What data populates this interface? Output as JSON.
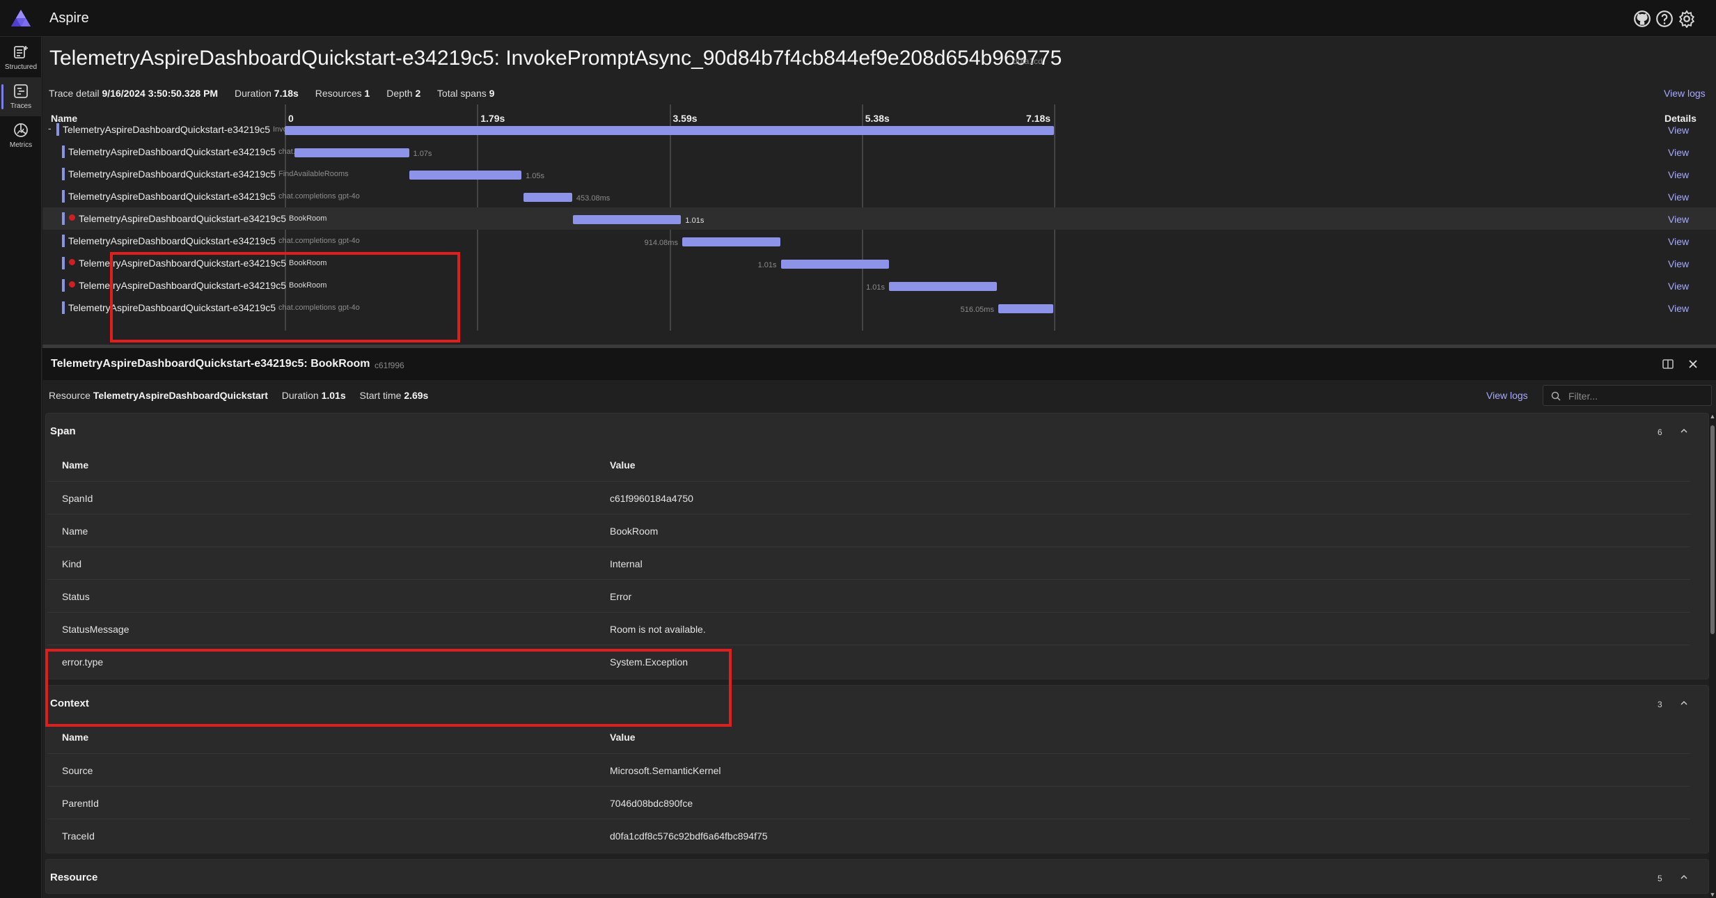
{
  "app": {
    "name": "Aspire"
  },
  "nav": {
    "items": [
      {
        "label": "Structured"
      },
      {
        "label": "Traces"
      },
      {
        "label": "Metrics"
      }
    ]
  },
  "trace": {
    "title": "TelemetryAspireDashboardQuickstart-e34219c5: InvokePromptAsync_90d84b7f4cb844ef9e208d654b969775",
    "trace_id_short": "d0fa1cd",
    "meta": {
      "detail_label": "Trace detail",
      "detail_value": "9/16/2024 3:50:50.328 PM",
      "duration_label": "Duration",
      "duration_value": "7.18s",
      "resources_label": "Resources",
      "resources_value": "1",
      "depth_label": "Depth",
      "depth_value": "2",
      "spans_label": "Total spans",
      "spans_value": "9"
    },
    "view_logs": "View logs",
    "columns": {
      "name": "Name",
      "details": "Details"
    },
    "ticks": [
      "0",
      "1.79s",
      "3.59s",
      "5.38s",
      "7.18s"
    ],
    "total_duration_s": 7.18,
    "rows": [
      {
        "name": "TelemetryAspireDashboardQuickstart-e34219c5",
        "operation": "InvokePromptAsync_90d84b7f4cb844ef9e...",
        "start_s": 0.0,
        "duration_s": 7.18,
        "label": "",
        "label_side": "right",
        "error": false,
        "level": 0,
        "toggle": "-",
        "view": "View"
      },
      {
        "name": "TelemetryAspireDashboardQuickstart-e34219c5",
        "operation": "chat.completions gpt-4o",
        "start_s": 0.09,
        "duration_s": 1.07,
        "label": "1.07s",
        "label_side": "right",
        "error": false,
        "level": 1,
        "toggle": "",
        "view": "View"
      },
      {
        "name": "TelemetryAspireDashboardQuickstart-e34219c5",
        "operation": "FindAvailableRooms",
        "start_s": 1.16,
        "duration_s": 1.05,
        "label": "1.05s",
        "label_side": "right",
        "error": false,
        "level": 1,
        "toggle": "",
        "view": "View"
      },
      {
        "name": "TelemetryAspireDashboardQuickstart-e34219c5",
        "operation": "chat.completions gpt-4o",
        "start_s": 2.23,
        "duration_s": 0.45308,
        "label": "453.08ms",
        "label_side": "right",
        "error": false,
        "level": 1,
        "toggle": "",
        "view": "View"
      },
      {
        "name": "TelemetryAspireDashboardQuickstart-e34219c5",
        "operation": "BookRoom",
        "start_s": 2.69,
        "duration_s": 1.01,
        "label": "1.01s",
        "label_side": "right",
        "error": true,
        "level": 1,
        "toggle": "",
        "view": "View",
        "selected": true
      },
      {
        "name": "TelemetryAspireDashboardQuickstart-e34219c5",
        "operation": "chat.completions gpt-4o",
        "start_s": 3.71,
        "duration_s": 0.91408,
        "label": "914.08ms",
        "label_side": "left",
        "error": false,
        "level": 1,
        "toggle": "",
        "view": "View"
      },
      {
        "name": "TelemetryAspireDashboardQuickstart-e34219c5",
        "operation": "BookRoom",
        "start_s": 4.63,
        "duration_s": 1.01,
        "label": "1.01s",
        "label_side": "left",
        "error": true,
        "level": 1,
        "toggle": "",
        "view": "View"
      },
      {
        "name": "TelemetryAspireDashboardQuickstart-e34219c5",
        "operation": "BookRoom",
        "start_s": 5.64,
        "duration_s": 1.01,
        "label": "1.01s",
        "label_side": "left",
        "error": true,
        "level": 1,
        "toggle": "",
        "view": "View"
      },
      {
        "name": "TelemetryAspireDashboardQuickstart-e34219c5",
        "operation": "chat.completions gpt-4o",
        "start_s": 6.66,
        "duration_s": 0.51605,
        "label": "516.05ms",
        "label_side": "left",
        "error": false,
        "level": 1,
        "toggle": "",
        "view": "View"
      }
    ]
  },
  "detail": {
    "title": "TelemetryAspireDashboardQuickstart-e34219c5: BookRoom",
    "span_id_short": "c61f996",
    "meta": {
      "resource_label": "Resource",
      "resource_value": "TelemetryAspireDashboardQuickstart",
      "duration_label": "Duration",
      "duration_value": "1.01s",
      "start_label": "Start time",
      "start_value": "2.69s"
    },
    "view_logs": "View logs",
    "filter_placeholder": "Filter...",
    "sections": [
      {
        "title": "Span",
        "count": "6",
        "header": {
          "k": "Name",
          "v": "Value"
        },
        "rows": [
          {
            "k": "SpanId",
            "v": "c61f9960184a4750"
          },
          {
            "k": "Name",
            "v": "BookRoom"
          },
          {
            "k": "Kind",
            "v": "Internal"
          },
          {
            "k": "Status",
            "v": "Error"
          },
          {
            "k": "StatusMessage",
            "v": "Room is not available."
          },
          {
            "k": "error.type",
            "v": "System.Exception"
          }
        ]
      },
      {
        "title": "Context",
        "count": "3",
        "header": {
          "k": "Name",
          "v": "Value"
        },
        "rows": [
          {
            "k": "Source",
            "v": "Microsoft.SemanticKernel"
          },
          {
            "k": "ParentId",
            "v": "7046d08bdc890fce"
          },
          {
            "k": "TraceId",
            "v": "d0fa1cdf8c576c92bdf6a64fbc894f75"
          }
        ]
      },
      {
        "title": "Resource",
        "count": "5",
        "header": {
          "k": "",
          "v": ""
        },
        "rows": []
      }
    ]
  },
  "colors": {
    "accent": "#8c93e8",
    "link": "#a6abff",
    "error": "#d21e1e",
    "highlight": "#e01e1e"
  }
}
